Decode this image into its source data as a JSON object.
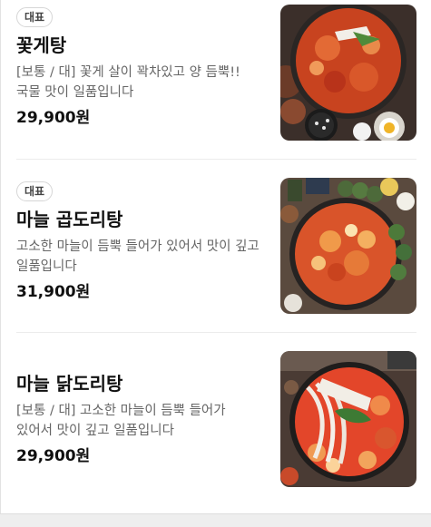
{
  "menu": {
    "items": [
      {
        "badge": "대표",
        "name": "꽃게탕",
        "description": "[보통 / 대] 꽃게 살이 꽉차있고 양 듬뿍!! 국물 맛이 일품입니다",
        "price": "29,900원",
        "image": "crab-stew-photo"
      },
      {
        "badge": "대표",
        "name": "마늘 곱도리탕",
        "description": "고소한 마늘이 듬뿍 들어가 있어서 맛이 깊고 일품입니다",
        "price": "31,900원",
        "image": "garlic-gopdoritang-photo"
      },
      {
        "badge": "",
        "name": "마늘 닭도리탕",
        "description": "[보통 / 대] 고소한 마늘이 듬뿍 들어가 있어서 맛이 깊고 일품입니다",
        "price": "29,900원",
        "image": "garlic-dakdoritang-photo"
      }
    ]
  },
  "colors": {
    "text_primary": "#111111",
    "text_secondary": "#666666",
    "badge_border": "#d6d6d6",
    "divider": "#ececec"
  }
}
